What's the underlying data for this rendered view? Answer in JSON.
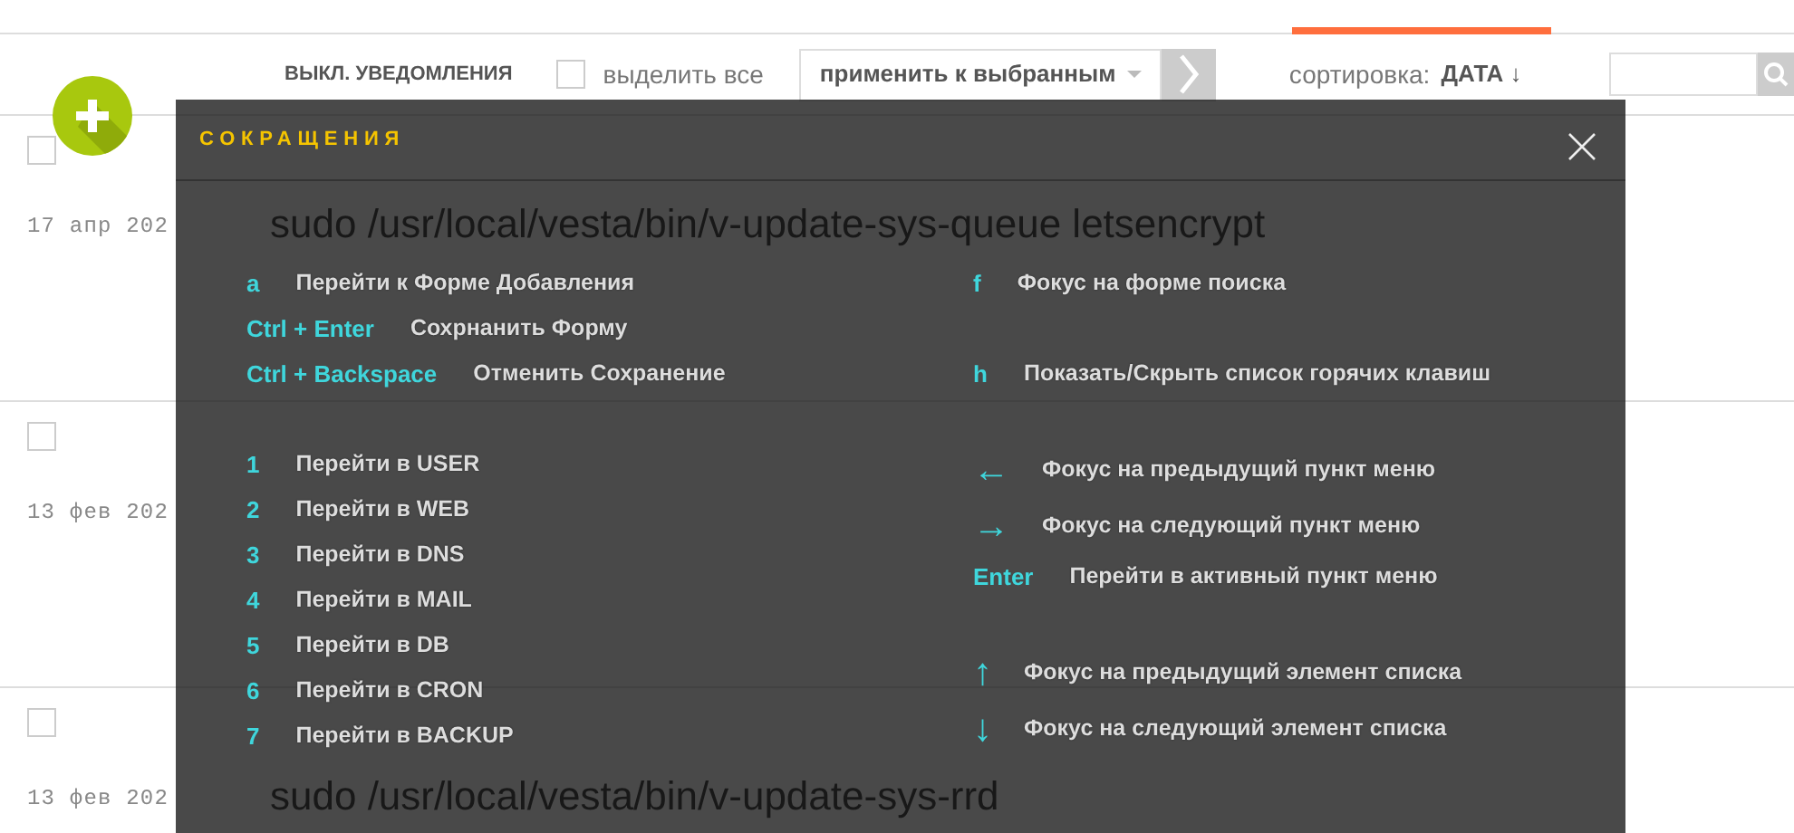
{
  "toolbar": {
    "notifications_toggle": "ВЫКЛ. УВЕДОМЛЕНИЯ",
    "select_all": {
      "label": "выделить все",
      "checked": false
    },
    "bulk_action": {
      "value": "применить к выбранным"
    },
    "sort": {
      "label": "сортировка:",
      "value": "ДАТА ↓"
    }
  },
  "jobs": [
    {
      "checked": false,
      "date": "17 апр 202",
      "command": "sudo /usr/local/vesta/bin/v-update-sys-queue letsencrypt"
    },
    {
      "checked": false,
      "date": "13 фев 202"
    },
    {
      "checked": false,
      "date": "13 фев 202",
      "command": "sudo /usr/local/vesta/bin/v-update-sys-rrd"
    }
  ],
  "modal": {
    "title": "СОКРАЩЕНИЯ",
    "columns": [
      {
        "groups": [
          [
            {
              "kind": "key",
              "key": "a",
              "action": "Перейти к Форме Добавления"
            },
            {
              "kind": "key",
              "key": "Ctrl + Enter",
              "action": "Сохрнанить Форму"
            },
            {
              "kind": "key",
              "key": "Ctrl + Backspace",
              "action": "Отменить Сохранение"
            }
          ],
          [
            {
              "kind": "key",
              "key": "1",
              "action": "Перейти в USER"
            },
            {
              "kind": "key",
              "key": "2",
              "action": "Перейти в WEB"
            },
            {
              "kind": "key",
              "key": "3",
              "action": "Перейти в DNS"
            },
            {
              "kind": "key",
              "key": "4",
              "action": "Перейти в MAIL"
            },
            {
              "kind": "key",
              "key": "5",
              "action": "Перейти в DB"
            },
            {
              "kind": "key",
              "key": "6",
              "action": "Перейти в CRON"
            },
            {
              "kind": "key",
              "key": "7",
              "action": "Перейти в BACKUP"
            }
          ]
        ]
      },
      {
        "groups": [
          [
            {
              "kind": "key",
              "key": "f",
              "action": "Фокус на форме поиска"
            }
          ],
          [
            {
              "kind": "key",
              "key": "h",
              "action": "Показать/Скрыть список горячих клавиш"
            }
          ],
          [
            {
              "kind": "arrow",
              "key": "←",
              "action": "Фокус на предыдущий пункт меню"
            },
            {
              "kind": "arrow",
              "key": "→",
              "action": "Фокус на следующий пункт меню"
            },
            {
              "kind": "key",
              "key": "Enter",
              "action": "Перейти в активный пункт меню"
            }
          ],
          [
            {
              "kind": "vertical-arrow",
              "key": "↑",
              "action": "Фокус на предыдущий элемент списка"
            },
            {
              "kind": "vertical-arrow",
              "key": "↓",
              "action": "Фокус на следующий элемент списка"
            }
          ]
        ]
      }
    ]
  }
}
